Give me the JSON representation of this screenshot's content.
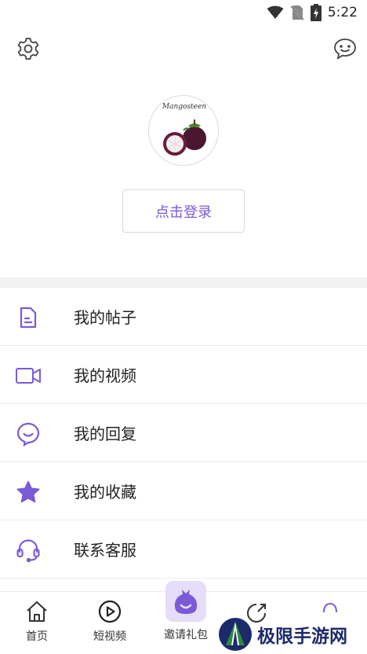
{
  "status_bar": {
    "time": "5:22"
  },
  "profile": {
    "avatar_caption": "Mangosteen",
    "login_label": "点击登录"
  },
  "menu": {
    "items": [
      {
        "label": "我的帖子",
        "icon": "document-icon"
      },
      {
        "label": "我的视频",
        "icon": "video-camera-icon"
      },
      {
        "label": "我的回复",
        "icon": "reply-bubble-icon"
      },
      {
        "label": "我的收藏",
        "icon": "star-icon"
      },
      {
        "label": "联系客服",
        "icon": "headset-icon"
      }
    ]
  },
  "bottom_nav": {
    "items": [
      {
        "label": "首页",
        "icon": "home-icon"
      },
      {
        "label": "短视频",
        "icon": "play-icon"
      },
      {
        "label": "邀请礼包",
        "icon": "gift-bag-icon"
      }
    ]
  },
  "watermark": {
    "text": "极限手游网"
  },
  "colors": {
    "accent": "#7b5ad8",
    "accent_light": "#e6ddf8"
  }
}
